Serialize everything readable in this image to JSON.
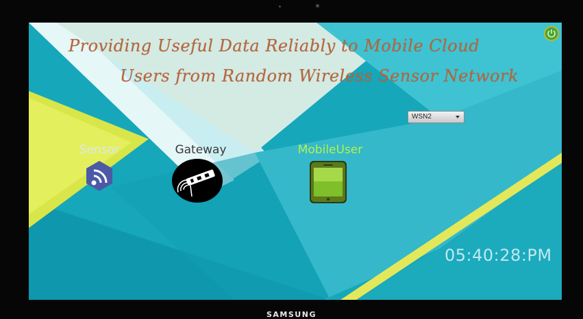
{
  "title_line1": "Providing Useful Data Reliably to Mobile Cloud",
  "title_line2": "Users from Random Wireless Sensor Network",
  "network_select": {
    "value": "WSN2"
  },
  "nodes": [
    {
      "label": "Sensor",
      "icon": "sensor-hexagon-icon",
      "color": "#d8e8f4"
    },
    {
      "label": "Gateway",
      "icon": "gateway-router-icon",
      "color": "#3a3a3a"
    },
    {
      "label": "MobileUser",
      "icon": "mobile-phone-icon",
      "color": "#b6f24a"
    }
  ],
  "clock": "05:40:28:PM",
  "device_brand": "SAMSUNG",
  "colors": {
    "screen_teal": "#12a3b8",
    "yellow_band": "#d9e84a",
    "title_text": "#b8643a"
  }
}
